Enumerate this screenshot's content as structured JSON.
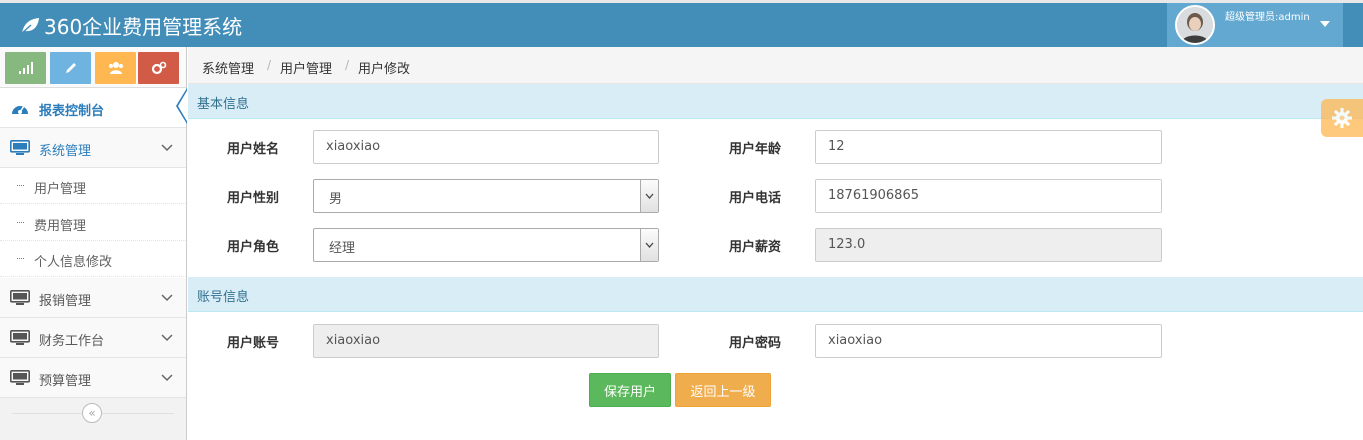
{
  "app": {
    "title": "360企业费用管理系统"
  },
  "user": {
    "label": "超级管理员:admin"
  },
  "sidebar": {
    "shortcut_icons": [
      "signal-icon",
      "pencil-icon",
      "users-icon",
      "cogs-icon"
    ],
    "items": [
      {
        "label": "报表控制台",
        "icon": "dashboard-icon",
        "active": true
      },
      {
        "label": "系统管理",
        "icon": "desktop-icon",
        "expanded": true
      },
      {
        "label": "报销管理",
        "icon": "desktop-icon"
      },
      {
        "label": "财务工作台",
        "icon": "desktop-icon"
      },
      {
        "label": "预算管理",
        "icon": "desktop-icon"
      }
    ],
    "submenu": [
      {
        "label": "用户管理"
      },
      {
        "label": "费用管理"
      },
      {
        "label": "个人信息修改"
      }
    ],
    "collapse_glyph": "«"
  },
  "breadcrumb": {
    "items": [
      "系统管理",
      "用户管理",
      "用户修改"
    ],
    "separator": "/"
  },
  "basic": {
    "title": "基本信息",
    "name_label": "用户姓名",
    "name_value": "xiaoxiao",
    "age_label": "用户年龄",
    "age_value": "12",
    "gender_label": "用户性别",
    "gender_value": "男",
    "phone_label": "用户电话",
    "phone_value": "18761906865",
    "role_label": "用户角色",
    "role_value": "经理",
    "salary_label": "用户薪资",
    "salary_value": "123.0"
  },
  "account": {
    "title": "账号信息",
    "account_label": "用户账号",
    "account_value": "xiaoxiao",
    "password_label": "用户密码",
    "password_value": "xiaoxiao"
  },
  "buttons": {
    "save": "保存用户",
    "back": "返回上一级"
  },
  "colors": {
    "navbar": "#438eb9",
    "user_box": "#62a8d1",
    "accent": "#2b7dbc",
    "section_bg": "#d9edf7",
    "save": "#5cb85c",
    "back": "#f0ad4e"
  }
}
